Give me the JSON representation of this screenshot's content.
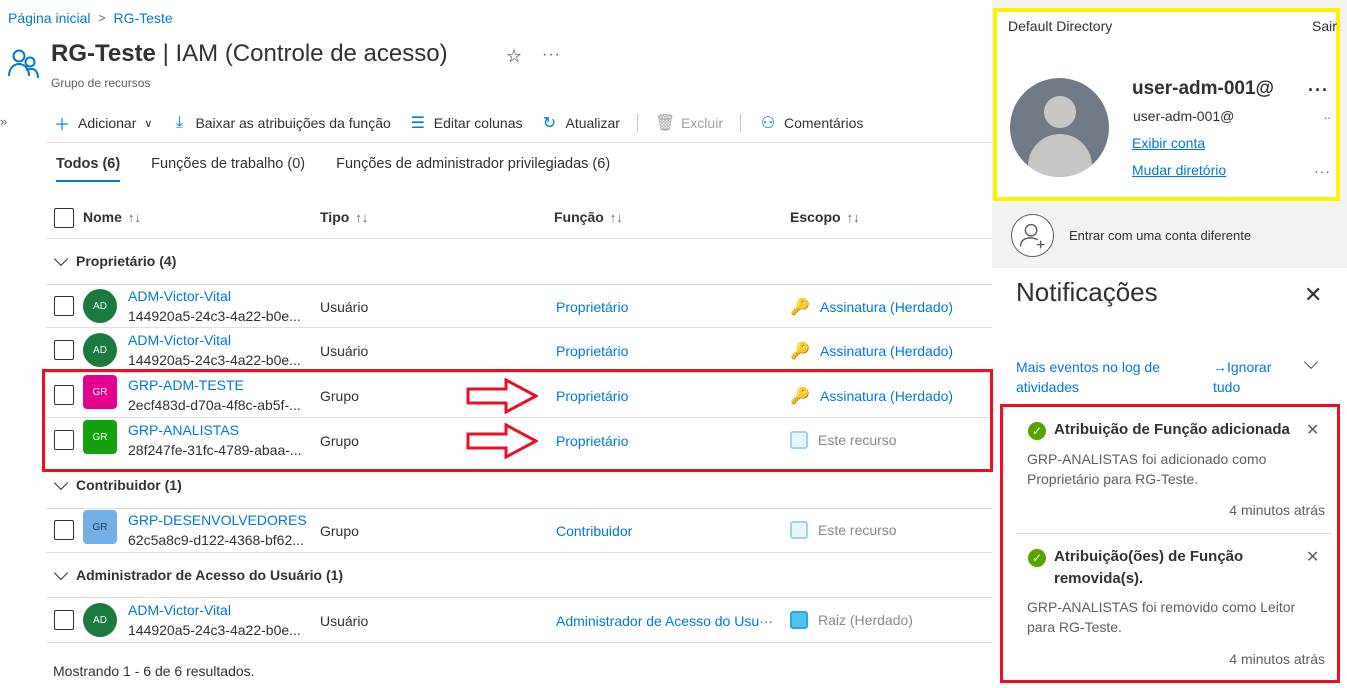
{
  "breadcrumb": {
    "home": "Página inicial",
    "current": "RG-Teste"
  },
  "header": {
    "title_bold": "RG-Teste",
    "title_rest": " | IAM (Controle de acesso)",
    "subtitle": "Grupo de recursos"
  },
  "toolbar": {
    "add": "Adicionar",
    "download": "Baixar as atribuições da função",
    "edit_columns": "Editar colunas",
    "refresh": "Atualizar",
    "delete": "Excluir",
    "feedback": "Comentários"
  },
  "tabs": [
    {
      "label": "Todos (6)",
      "active": true
    },
    {
      "label": "Funções de trabalho (0)",
      "active": false
    },
    {
      "label": "Funções de administrador privilegiadas (6)",
      "active": false
    }
  ],
  "columns": {
    "name": "Nome",
    "type": "Tipo",
    "role": "Função",
    "scope": "Escopo"
  },
  "groups": {
    "owner": "Proprietário (4)",
    "contributor": "Contribuidor (1)",
    "uaa": "Administrador de Acesso do Usuário (1)"
  },
  "rows": [
    {
      "initials": "AD",
      "name": "ADM-Victor-Vital",
      "id": "144920a5-24c3-4a22-b0e...",
      "type": "Usuário",
      "role": "Proprietário",
      "scope": "Assinatura (Herdado)"
    },
    {
      "initials": "AD",
      "name": "ADM-Victor-Vital",
      "id": "144920a5-24c3-4a22-b0e...",
      "type": "Usuário",
      "role": "Proprietário",
      "scope": "Assinatura (Herdado)"
    },
    {
      "initials": "GR",
      "name": "GRP-ADM-TESTE",
      "id": "2ecf483d-d70a-4f8c-ab5f-...",
      "type": "Grupo",
      "role": "Proprietário",
      "scope": "Assinatura (Herdado)",
      "color": "#e3008c"
    },
    {
      "initials": "GR",
      "name": "GRP-ANALISTAS",
      "id": "28f247fe-31fc-4789-abaa-...",
      "type": "Grupo",
      "role": "Proprietário",
      "scope": "Este recurso",
      "color": "#13a10e"
    },
    {
      "initials": "GR",
      "name": "GRP-DESENVOLVEDORES",
      "id": "62c5a8c9-d122-4368-bf62...",
      "type": "Grupo",
      "role": "Contribuidor",
      "scope": "Este recurso",
      "color": "#71afe5"
    },
    {
      "initials": "AD",
      "name": "ADM-Victor-Vital",
      "id": "144920a5-24c3-4a22-b0e...",
      "type": "Usuário",
      "role": "Administrador de Acesso do Usu···",
      "scope": "Raiz (Herdado)"
    }
  ],
  "footer": "Mostrando 1 - 6 de 6 resultados.",
  "account": {
    "directory": "Default Directory",
    "signout": "Sair",
    "username": "user-adm-001@",
    "email": "user-adm-001@",
    "view_account": "Exibir conta",
    "switch_directory": "Mudar diretório",
    "other_account": "Entrar com uma conta diferente"
  },
  "notifications": {
    "title": "Notificações",
    "more_events": "Mais eventos no log de atividades",
    "ignore_all": "→Ignorar tudo",
    "items": [
      {
        "title": "Atribuição de Função adicionada",
        "body": "GRP-ANALISTAS foi adicionado como Proprietário para RG-Teste.",
        "time": "4 minutos atrás"
      },
      {
        "title": "Atribuição(ões) de Função removida(s).",
        "body": "GRP-ANALISTAS foi removido como Leitor para RG-Teste.",
        "time": "4 minutos atrás"
      }
    ]
  },
  "colors": {
    "accent": "#0078d4",
    "highlight_red": "#e81123",
    "highlight_yellow": "#fff200"
  }
}
